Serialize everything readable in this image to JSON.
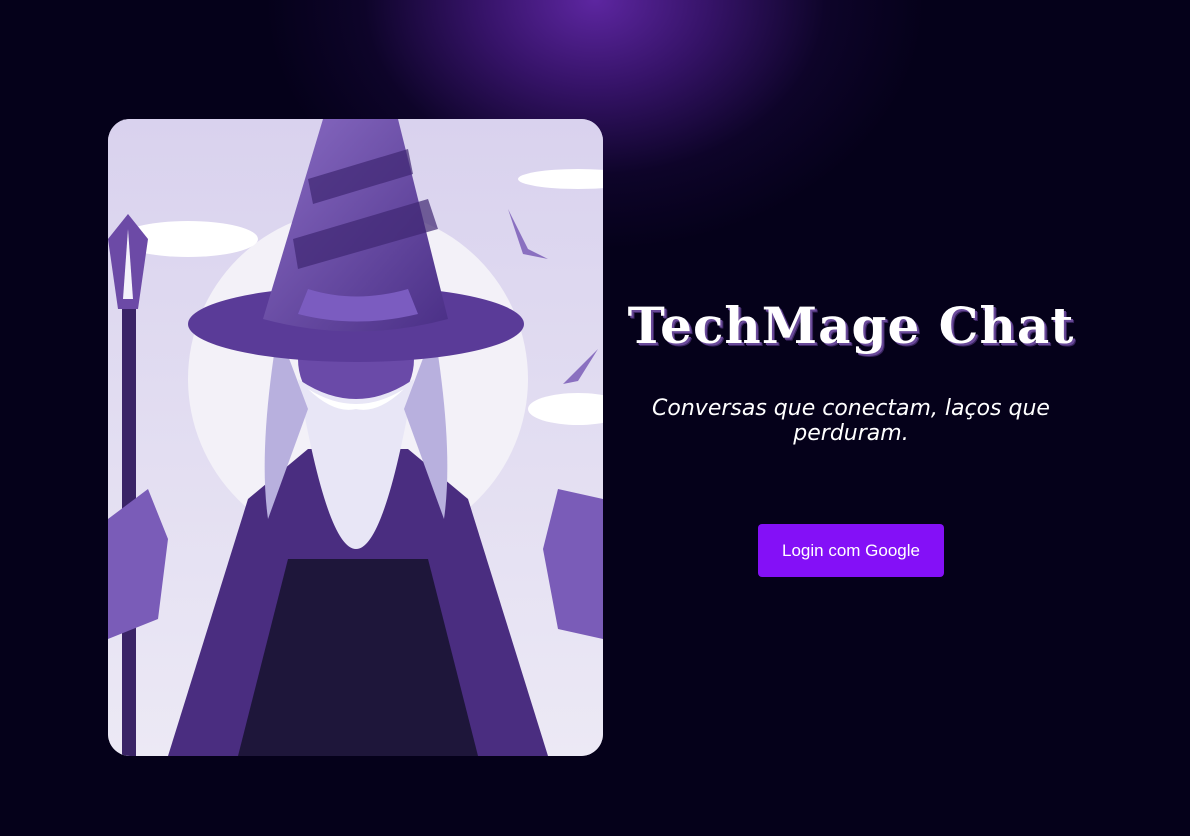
{
  "app": {
    "title": "TechMage Chat",
    "tagline": "Conversas que conectam, laços que perduram."
  },
  "hero": {
    "image_subject": "wizard-illustration"
  },
  "login": {
    "button_label": "Login com Google"
  },
  "colors": {
    "background": "#05011a",
    "glow": "#5a2496",
    "button": "#8410f7",
    "text": "#ffffff"
  }
}
